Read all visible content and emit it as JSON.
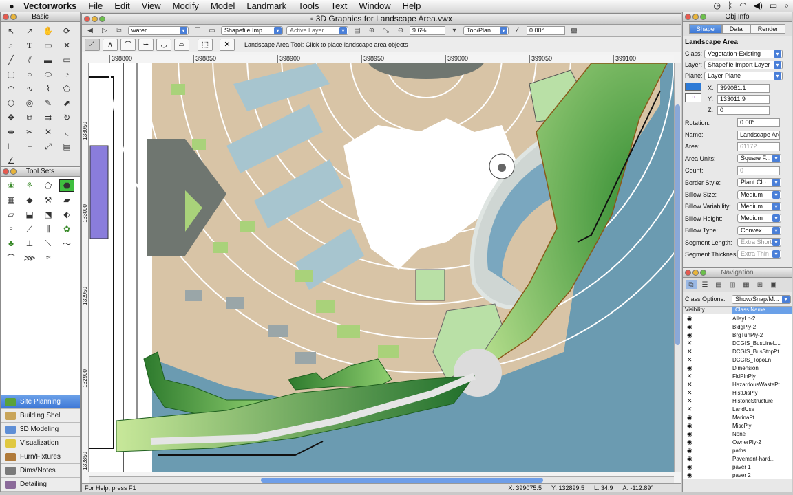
{
  "menubar": {
    "app": "Vectorworks",
    "items": [
      "File",
      "Edit",
      "View",
      "Modify",
      "Model",
      "Landmark",
      "Tools",
      "Text",
      "Window",
      "Help"
    ]
  },
  "panels": {
    "basic_title": "Basic",
    "toolsets_title": "Tool Sets",
    "objinfo_title": "Obj Info",
    "navigation_title": "Navigation"
  },
  "toolsets": [
    {
      "label": "Site Planning",
      "selected": true,
      "color": "#5aa23a"
    },
    {
      "label": "Building Shell",
      "selected": false,
      "color": "#c9a55a"
    },
    {
      "label": "3D Modeling",
      "selected": false,
      "color": "#5f8fd6"
    },
    {
      "label": "Visualization",
      "selected": false,
      "color": "#e0c840"
    },
    {
      "label": "Furn/Fixtures",
      "selected": false,
      "color": "#b07a3a"
    },
    {
      "label": "Dims/Notes",
      "selected": false,
      "color": "#7a7a7a"
    },
    {
      "label": "Detailing",
      "selected": false,
      "color": "#8b6a9a"
    }
  ],
  "document": {
    "title": "3D Graphics for Landscape Area.vwx",
    "class_select": "water",
    "layer_import": "Shapefile Imp...",
    "active_layer": "Active Layer ...",
    "zoom": "9.6%",
    "view": "Top/Plan",
    "rotation": "0.00°",
    "tool_hint": "Landscape Area Tool: Click to place landscape area objects",
    "ruler_h": [
      "398800",
      "398850",
      "398900",
      "398950",
      "399000",
      "399050",
      "399100"
    ],
    "ruler_v": [
      "133050",
      "133000",
      "132950",
      "132900",
      "132850"
    ],
    "status_help": "For Help, press F1",
    "status_x": "X: 399075.5",
    "status_y": "Y: 132899.5",
    "status_l": "L: 34.9",
    "status_a": "A: -112.89°"
  },
  "objinfo": {
    "tabs": [
      "Shape",
      "Data",
      "Render"
    ],
    "active_tab": "Shape",
    "heading": "Landscape Area",
    "class_label": "Class:",
    "class_value": "Vegetation-Existing",
    "layer_label": "Layer:",
    "layer_value": "Shapefile Import Layer",
    "plane_label": "Plane:",
    "plane_value": "Layer Plane",
    "x_label": "X:",
    "x_value": "399081.1",
    "y_label": "Y:",
    "y_value": "133011.9",
    "z_label": "Z:",
    "z_value": "0",
    "props": [
      {
        "label": "Rotation:",
        "value": "0.00°",
        "kind": "field"
      },
      {
        "label": "Name:",
        "value": "Landscape Area",
        "kind": "field"
      },
      {
        "label": "Area:",
        "value": "61172",
        "kind": "grey"
      },
      {
        "label": "Area Units:",
        "value": "Square F...",
        "kind": "select"
      },
      {
        "label": "Count:",
        "value": "0",
        "kind": "grey"
      },
      {
        "label": "Border Style:",
        "value": "Plant Clo...",
        "kind": "select"
      },
      {
        "label": "Billow Size:",
        "value": "Medium",
        "kind": "select"
      },
      {
        "label": "Billow Variability:",
        "value": "Medium",
        "kind": "select"
      },
      {
        "label": "Billow Height:",
        "value": "Medium",
        "kind": "select"
      },
      {
        "label": "Billow Type:",
        "value": "Convex",
        "kind": "select"
      },
      {
        "label": "Segment Length:",
        "value": "Extra Short",
        "kind": "disabled"
      },
      {
        "label": "Segment Thickness:",
        "value": "Extra Thin",
        "kind": "disabled"
      }
    ]
  },
  "navigation": {
    "class_options_label": "Class Options:",
    "class_options_value": "Show/Snap/M...",
    "col_visibility": "Visibility",
    "col_classname": "Class Name",
    "rows": [
      {
        "name": "AlleyLn-2",
        "vis": "eye"
      },
      {
        "name": "BldgPly-2",
        "vis": "eye"
      },
      {
        "name": "BrgTunPly-2",
        "vis": "eye"
      },
      {
        "name": "DCGIS_BusLineL...",
        "vis": "x"
      },
      {
        "name": "DCGIS_BusStopPt",
        "vis": "x"
      },
      {
        "name": "DCGIS_TopoLn",
        "vis": "x"
      },
      {
        "name": "Dimension",
        "vis": "eye"
      },
      {
        "name": "FldPlnPly",
        "vis": "x"
      },
      {
        "name": "HazardousWastePt",
        "vis": "x"
      },
      {
        "name": "HistDisPly",
        "vis": "x"
      },
      {
        "name": "HistoricStructure",
        "vis": "x"
      },
      {
        "name": "LandUse",
        "vis": "x"
      },
      {
        "name": "MarinaPt",
        "vis": "eye"
      },
      {
        "name": "MiscPly",
        "vis": "eye"
      },
      {
        "name": "None",
        "vis": "eye"
      },
      {
        "name": "OwnerPly-2",
        "vis": "eye"
      },
      {
        "name": "paths",
        "vis": "eye"
      },
      {
        "name": "Pavement-hard...",
        "vis": "eye"
      },
      {
        "name": "paver 1",
        "vis": "eye"
      },
      {
        "name": "paver 2",
        "vis": "eye"
      }
    ]
  }
}
